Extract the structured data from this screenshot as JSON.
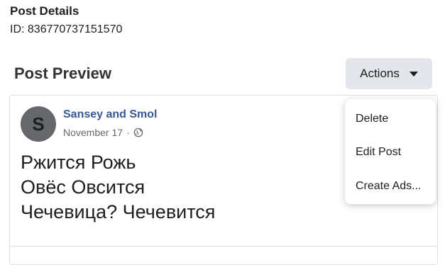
{
  "details": {
    "title": "Post Details",
    "id": "ID: 836770737151570"
  },
  "preview": {
    "title": "Post Preview",
    "actions_label": "Actions"
  },
  "post": {
    "avatar_letter": "S",
    "author": "Sansey and Smol",
    "date": "November 17",
    "separator": "·",
    "privacy_icon": "globe-icon",
    "lines": [
      "Ржится Рожь",
      "Овёс Овсится",
      "Чечевица? Чечевится"
    ]
  },
  "menu": {
    "items": [
      "Delete",
      "Edit Post",
      "Create Ads..."
    ]
  }
}
